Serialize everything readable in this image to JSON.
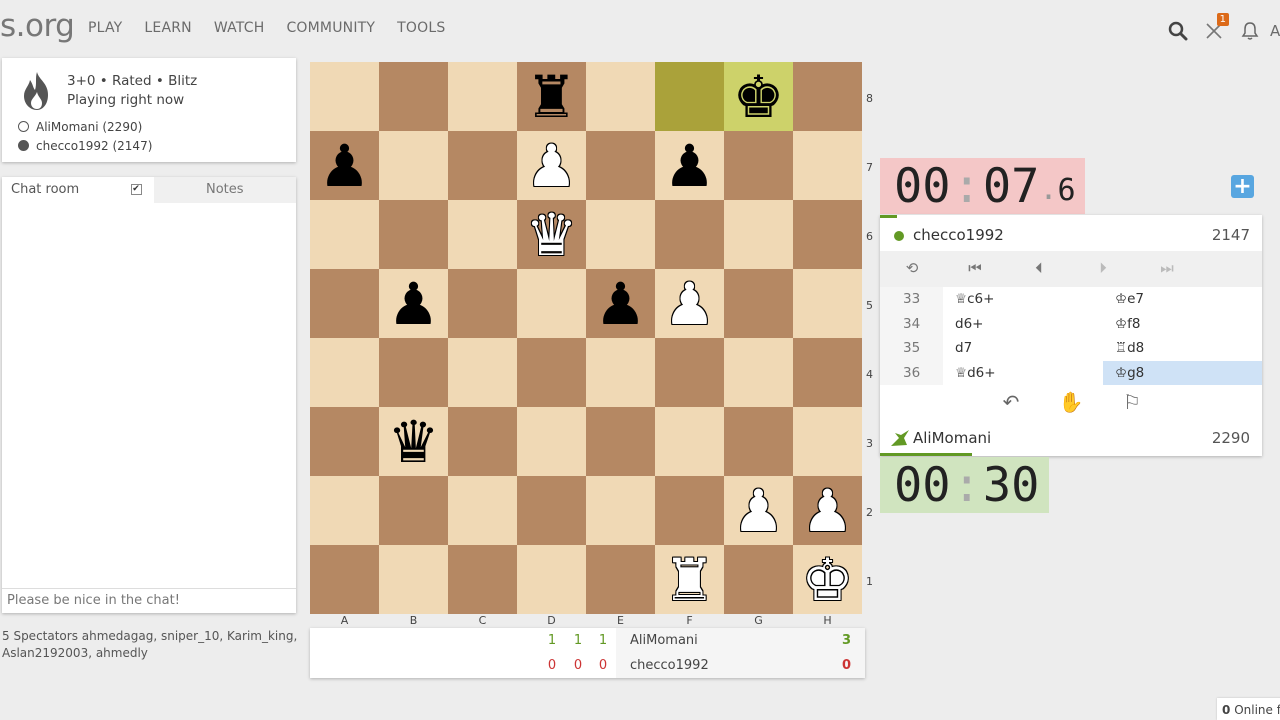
{
  "header": {
    "logo_text": "s.org",
    "nav": [
      "PLAY",
      "LEARN",
      "WATCH",
      "COMMUNITY",
      "TOOLS"
    ],
    "icons": [
      "search-icon",
      "crossed-swords-icon",
      "bell-icon"
    ],
    "challenge_badge": "1",
    "cut_text": "A"
  },
  "game_info": {
    "mode": "3+0 • Rated • Blitz",
    "status": "Playing right now",
    "white_player": "AliMomani (2290)",
    "black_player": "checco1992 (2147)"
  },
  "chat": {
    "tab_chat": "Chat room",
    "tab_notes": "Notes",
    "checkbox_mark": "✔",
    "input_placeholder": "Please be nice in the chat!"
  },
  "spectators": "5 Spectators ahmedagag, sniper_10, Karim_king, Aslan2192003, ahmedly",
  "board": {
    "ranks": [
      "8",
      "7",
      "6",
      "5",
      "4",
      "3",
      "2",
      "1"
    ],
    "files": [
      "A",
      "B",
      "C",
      "D",
      "E",
      "F",
      "G",
      "H"
    ],
    "rows": [
      [
        "",
        "",
        "",
        "r",
        "",
        "",
        "k",
        ""
      ],
      [
        "p",
        "",
        "",
        "P",
        "",
        "p",
        "",
        ""
      ],
      [
        "",
        "",
        "",
        "Q",
        "",
        "",
        "",
        ""
      ],
      [
        "",
        "p",
        "",
        "",
        "p",
        "P",
        "",
        ""
      ],
      [
        "",
        "",
        "",
        "",
        "",
        "",
        "",
        ""
      ],
      [
        "",
        "q",
        "",
        "",
        "",
        "",
        "",
        ""
      ],
      [
        "",
        "",
        "",
        "",
        "",
        "",
        "P",
        "P"
      ],
      [
        "",
        "",
        "",
        "",
        "",
        "R",
        "",
        "K"
      ]
    ],
    "last_move": [
      "f8",
      "g8"
    ],
    "colors": {
      "light": "#f0d9b5",
      "dark": "#b58863",
      "last_dark": "#aaa23a",
      "last_light": "#cdd26a"
    }
  },
  "crosstable": {
    "row1": {
      "scores": [
        "1",
        "1",
        "1"
      ],
      "name": "AliMomani",
      "total": "3"
    },
    "row2": {
      "scores": [
        "0",
        "0",
        "0"
      ],
      "name": "checco1992",
      "total": "0"
    }
  },
  "clock_top": {
    "mm": "00",
    "sep": ":",
    "ss": "07",
    "dot": ".",
    "tenths": "6"
  },
  "clock_bottom": {
    "mm": "00",
    "sep": ":",
    "ss": "30"
  },
  "top_player": {
    "name": "checco1992",
    "rating": "2147"
  },
  "bottom_player": {
    "name": "AliMomani",
    "rating": "2290"
  },
  "controls": {
    "flip": "⟲",
    "first": "⏮",
    "prev": "⏴",
    "next": "⏵",
    "last": "⏭"
  },
  "moves": [
    {
      "num": "33",
      "white": "♕c6+",
      "black": "♔e7"
    },
    {
      "num": "34",
      "white": "d6+",
      "black": "♔f8"
    },
    {
      "num": "35",
      "white": "d7",
      "black": "♖d8"
    },
    {
      "num": "36",
      "white": "♕d6+",
      "black": "♔g8"
    }
  ],
  "actions": {
    "takeback": "↶",
    "draw": "✋",
    "resign": "⚐"
  },
  "plus_label": "+",
  "online_friends": {
    "count": "0",
    "label": "Online fr"
  }
}
